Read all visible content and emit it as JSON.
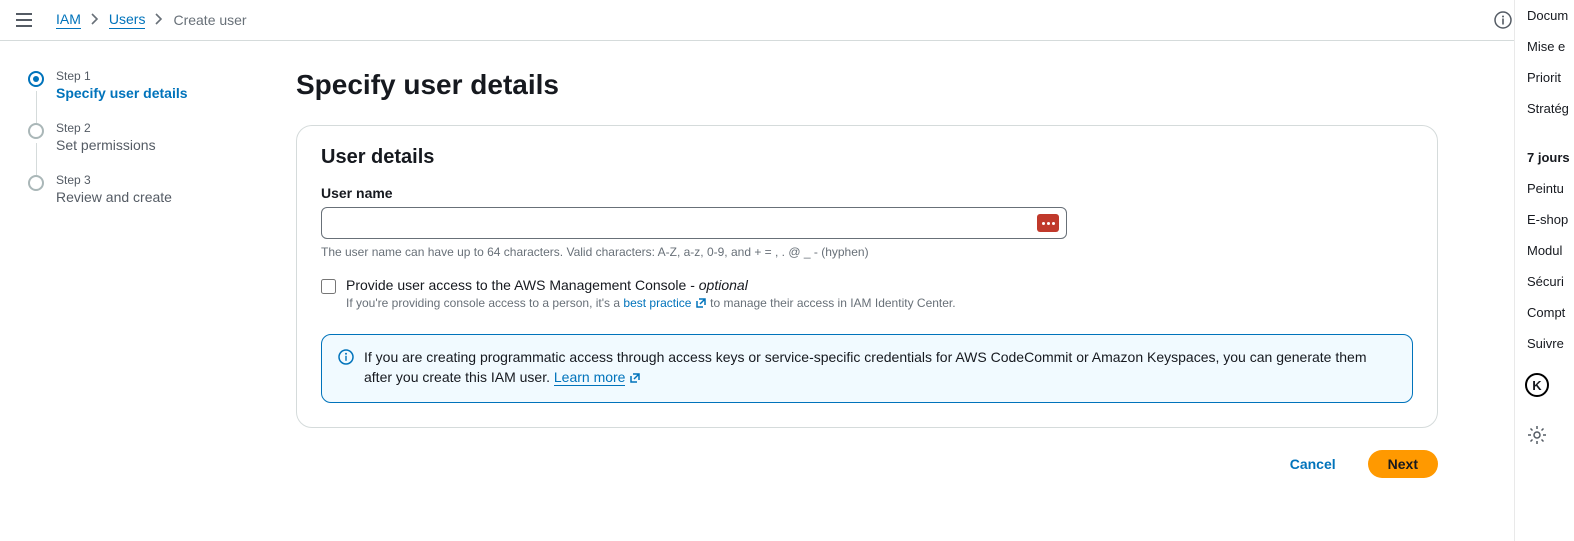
{
  "breadcrumb": {
    "root": "IAM",
    "mid": "Users",
    "current": "Create user"
  },
  "page": {
    "title": "Specify user details"
  },
  "wizard": {
    "step1_label": "Step 1",
    "step1_title": "Specify user details",
    "step2_label": "Step 2",
    "step2_title": "Set permissions",
    "step3_label": "Step 3",
    "step3_title": "Review and create"
  },
  "panel": {
    "title": "User details",
    "username_label": "User name",
    "username_value": "",
    "username_hint": "The user name can have up to 64 characters. Valid characters: A-Z, a-z, 0-9, and + = , . @ _ - (hyphen)",
    "checkbox_prefix": "Provide user access to the AWS Management Console - ",
    "checkbox_optional": "optional",
    "checkbox_sub_prefix": "If you're providing console access to a person, it's a ",
    "checkbox_sub_link": "best practice",
    "checkbox_sub_suffix": " to manage their access in IAM Identity Center.",
    "info_text": "If you are creating programmatic access through access keys or service-specific credentials for AWS CodeCommit or Amazon Keyspaces, you can generate them after you create this IAM user. ",
    "info_link": "Learn more"
  },
  "buttons": {
    "cancel": "Cancel",
    "next": "Next"
  },
  "drawer": {
    "items": [
      "Docum",
      "Mise e",
      "Priorit",
      "Stratég"
    ],
    "heading": "7 jours",
    "items2": [
      "Peintu",
      "E-shop",
      "Modul",
      "Sécuri",
      "Compt",
      "Suivre"
    ],
    "badge": "K"
  }
}
